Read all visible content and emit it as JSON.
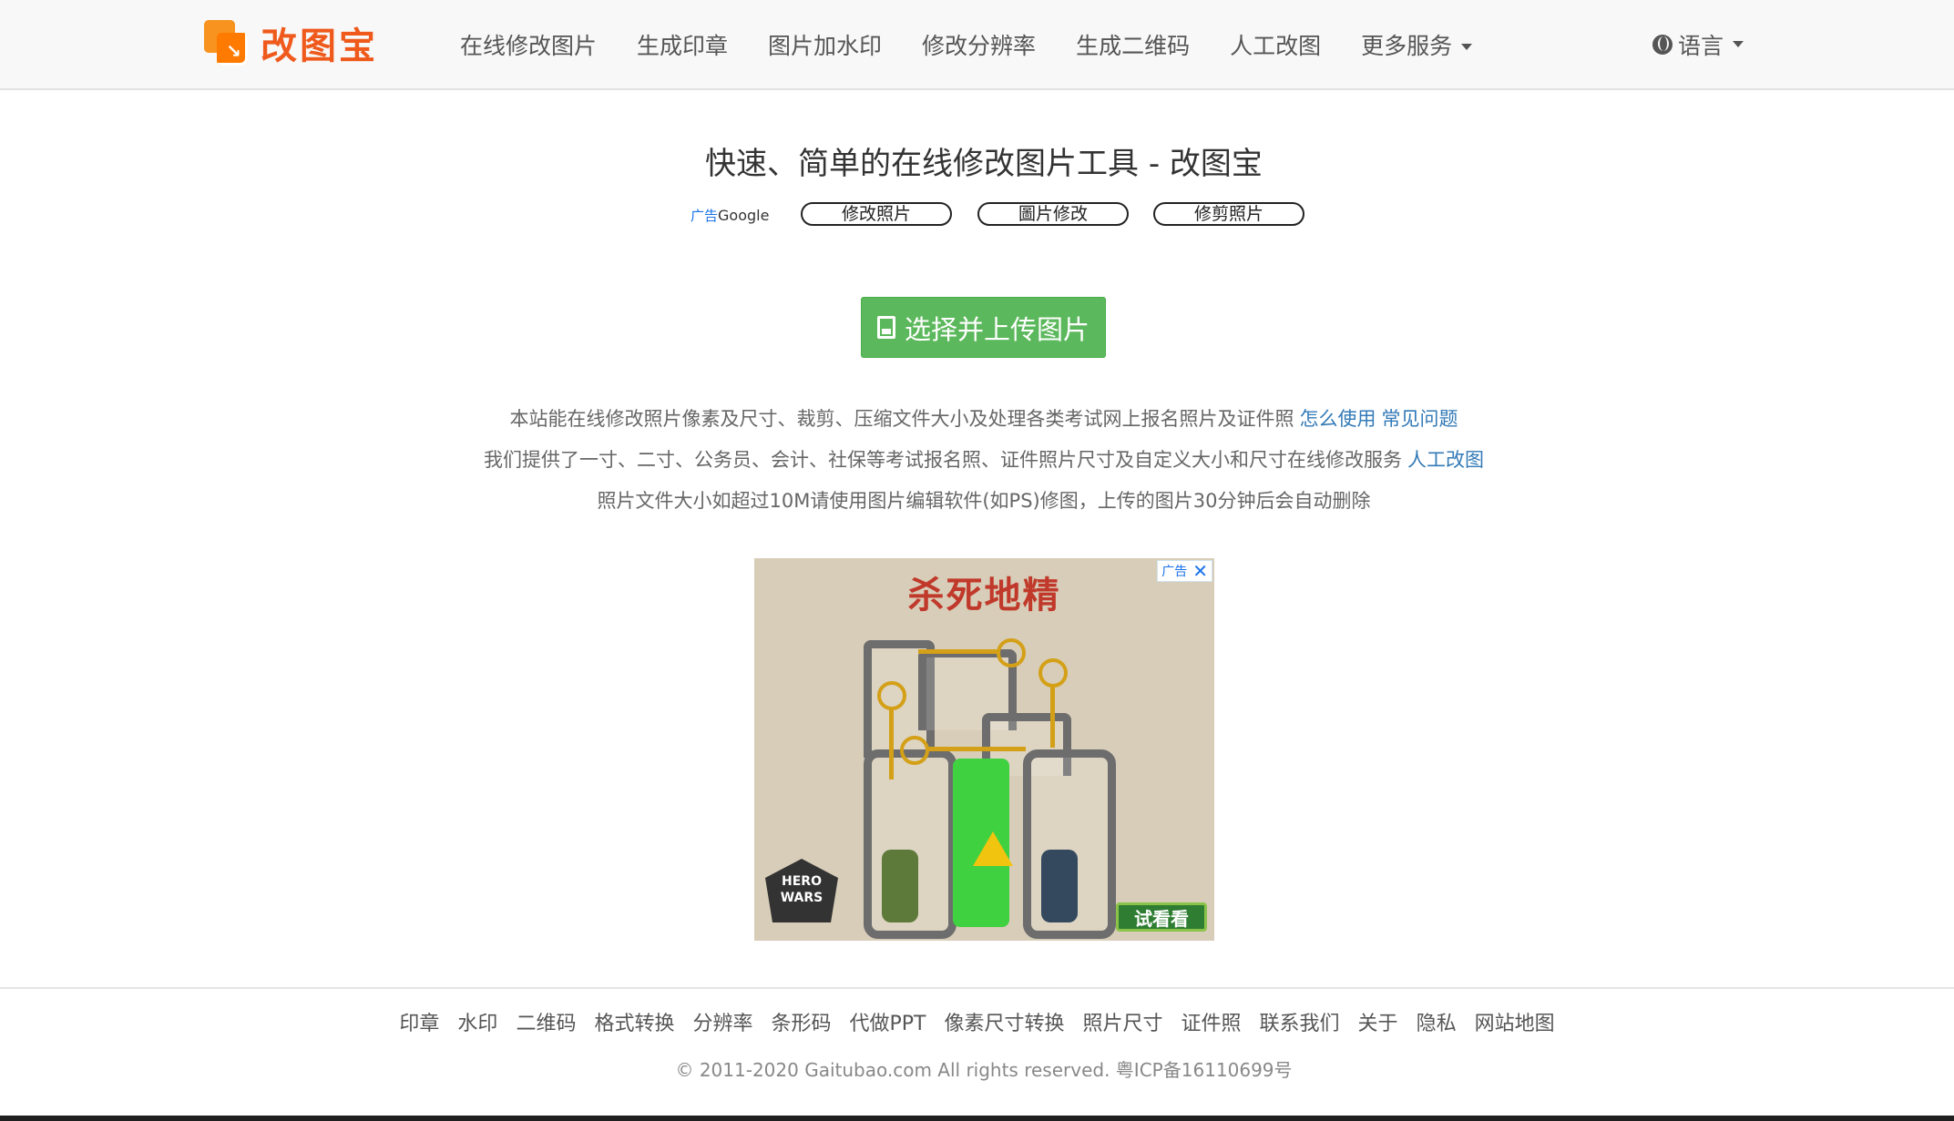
{
  "brand": {
    "name": "改图宝",
    "color": "#ef5a1c"
  },
  "nav": {
    "items": [
      "在线修改图片",
      "生成印章",
      "图片加水印",
      "修改分辨率",
      "生成二维码",
      "人工改图"
    ],
    "more_label": "更多服务",
    "language_label": "语言"
  },
  "main": {
    "title": "快速、简单的在线修改图片工具 - 改图宝",
    "ad_label_prefix": "广告",
    "ad_label_brand": "Google",
    "ad_pills": [
      "修改照片",
      "圖片修改",
      "修剪照片"
    ],
    "upload_button": "选择并上传图片",
    "upload_color": "#5cb85c",
    "desc_line1": "本站能在线修改照片像素及尺寸、裁剪、压缩文件大小及处理各类考试网上报名照片及证件照",
    "desc_line1_links": [
      "怎么使用",
      "常见问题"
    ],
    "desc_line2": "我们提供了一寸、二寸、公务员、会计、社保等考试报名照、证件照片尺寸及自定义大小和尺寸在线修改服务",
    "desc_line2_link": "人工改图",
    "desc_line3": "照片文件大小如超过10M请使用图片编辑软件(如PS)修图，上传的图片30分钟后会自动删除"
  },
  "ad": {
    "title": "杀死地精",
    "badge": "广告",
    "close": "✕",
    "logo_line1": "HERO",
    "logo_line2": "WARS",
    "cta": "试看看"
  },
  "footer": {
    "links": [
      "印章",
      "水印",
      "二维码",
      "格式转换",
      "分辨率",
      "条形码",
      "代做PPT",
      "像素尺寸转换",
      "照片尺寸",
      "证件照",
      "联系我们",
      "关于",
      "隐私",
      "网站地图"
    ],
    "copyright": "© 2011-2020 Gaitubao.com All rights reserved. 粤ICP备16110699号"
  }
}
